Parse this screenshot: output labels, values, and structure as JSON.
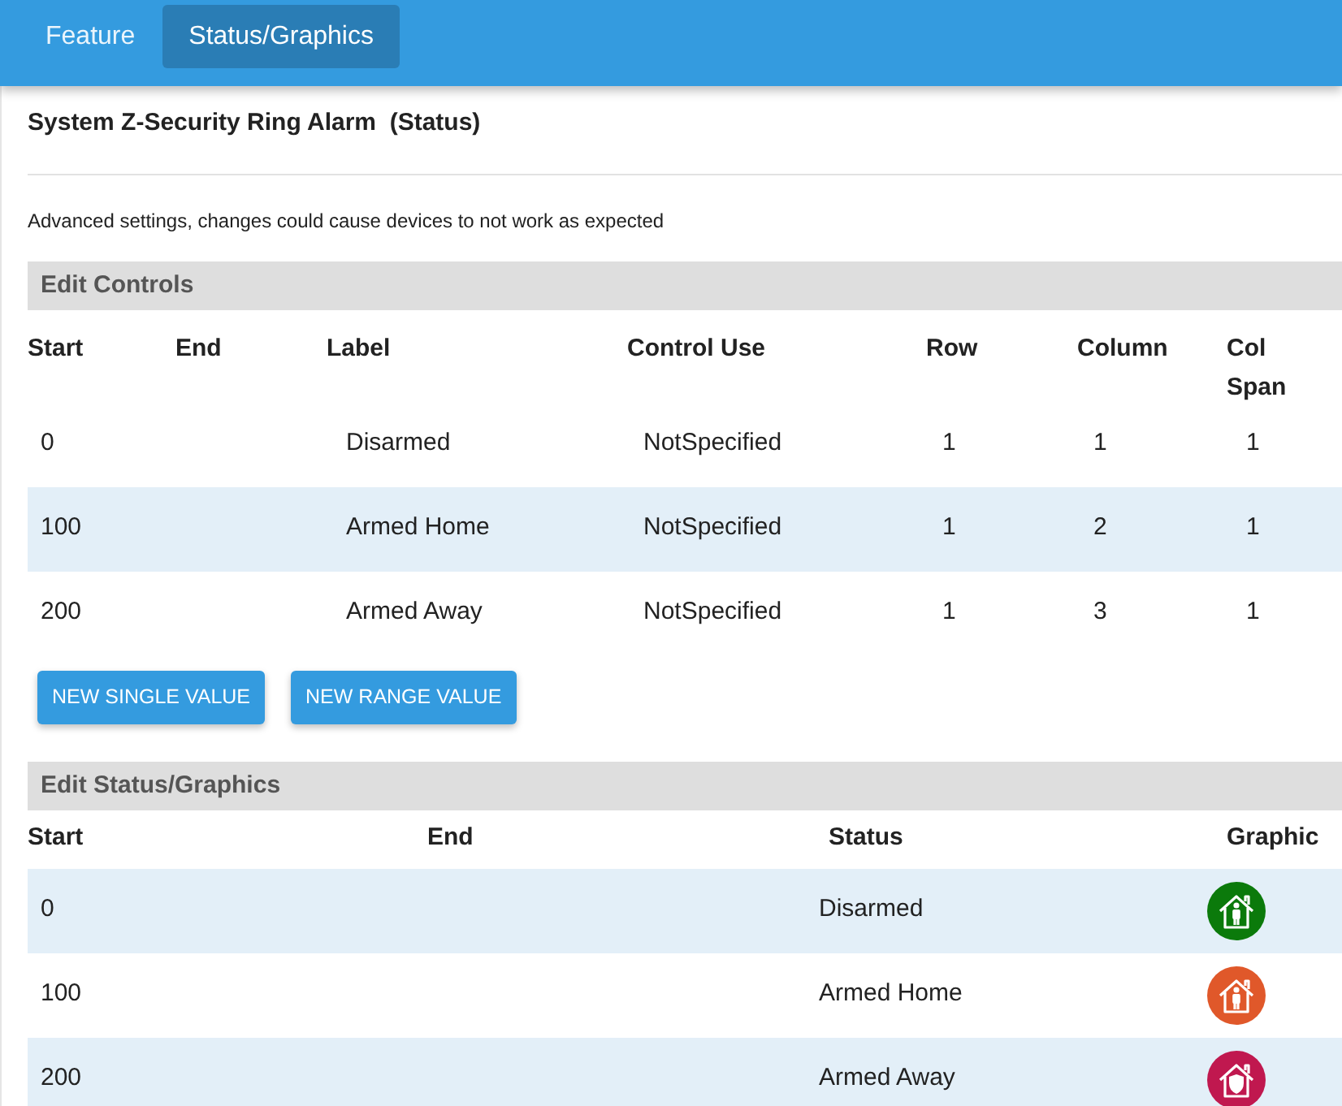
{
  "tabs": [
    {
      "label": "Feature",
      "selected": false
    },
    {
      "label": "Status/Graphics",
      "selected": true
    }
  ],
  "title": "System Z-Security Ring Alarm  (Status)",
  "notice": "Advanced settings, changes could cause devices to not work as expected",
  "controls": {
    "heading": "Edit Controls",
    "columns": [
      "Start",
      "End",
      "Label",
      "Control Use",
      "Row",
      "Column",
      "Col Span"
    ],
    "rows": [
      {
        "start": "0",
        "end": "",
        "label": "Disarmed",
        "control_use": "NotSpecified",
        "row": "1",
        "column": "1",
        "col_span": "1"
      },
      {
        "start": "100",
        "end": "",
        "label": "Armed Home",
        "control_use": "NotSpecified",
        "row": "1",
        "column": "2",
        "col_span": "1"
      },
      {
        "start": "200",
        "end": "",
        "label": "Armed Away",
        "control_use": "NotSpecified",
        "row": "1",
        "column": "3",
        "col_span": "1"
      }
    ],
    "buttons": [
      "NEW SINGLE VALUE",
      "NEW RANGE VALUE"
    ]
  },
  "status": {
    "heading": "Edit Status/Graphics",
    "columns": [
      "Start",
      "End",
      "Status",
      "Graphic"
    ],
    "rows": [
      {
        "start": "0",
        "status": "Disarmed",
        "graphic": {
          "kind": "person",
          "color": "#0b7a0b"
        }
      },
      {
        "start": "100",
        "status": "Armed Home",
        "graphic": {
          "kind": "person",
          "color": "#e0582a"
        }
      },
      {
        "start": "200",
        "status": "Armed Away",
        "graphic": {
          "kind": "shield",
          "color": "#c0184f"
        }
      }
    ]
  }
}
